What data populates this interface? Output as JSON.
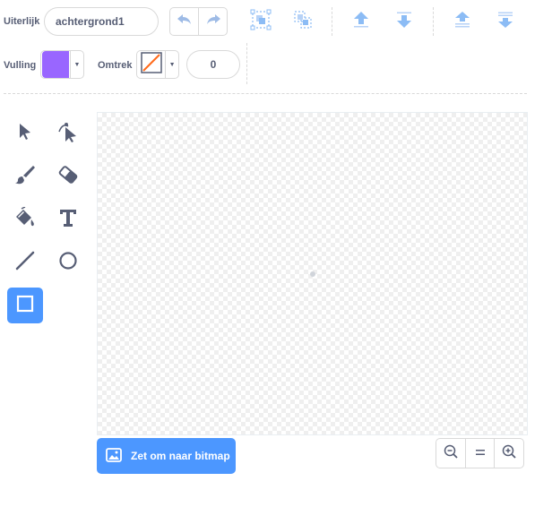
{
  "costume": {
    "label": "Uiterlijk",
    "name": "achtergrond1"
  },
  "history": {
    "undo_icon": "undo-icon",
    "redo_icon": "redo-icon"
  },
  "arrange": {
    "group_icon": "group-icon",
    "ungroup_icon": "ungroup-icon",
    "forward_icon": "forward-icon",
    "backward_icon": "backward-icon",
    "front_icon": "front-icon",
    "back_icon": "back-icon"
  },
  "fill": {
    "label": "Vulling",
    "color": "#9966ff"
  },
  "outline": {
    "label": "Omtrek",
    "color": "none",
    "width": "0"
  },
  "tools": [
    {
      "name": "select",
      "icon": "select-arrow-icon",
      "active": false
    },
    {
      "name": "reshape",
      "icon": "reshape-icon",
      "active": false
    },
    {
      "name": "brush",
      "icon": "brush-icon",
      "active": false
    },
    {
      "name": "eraser",
      "icon": "eraser-icon",
      "active": false
    },
    {
      "name": "fill",
      "icon": "paint-bucket-icon",
      "active": false
    },
    {
      "name": "text",
      "icon": "text-icon",
      "active": false
    },
    {
      "name": "line",
      "icon": "line-icon",
      "active": false
    },
    {
      "name": "circle",
      "icon": "circle-icon",
      "active": false
    },
    {
      "name": "rectangle",
      "icon": "rectangle-icon",
      "active": true
    }
  ],
  "bitmap_button": {
    "label": "Zet om naar bitmap",
    "icon": "image-icon"
  },
  "zoom": {
    "zoom_out_icon": "zoom-out-icon",
    "reset_icon": "zoom-reset-icon",
    "zoom_in_icon": "zoom-in-icon"
  },
  "colors": {
    "accent": "#4c97ff",
    "icon_light": "#8cbcf5",
    "icon_dark": "#575e75",
    "stroke_none_slash": "#ff6a1a"
  }
}
